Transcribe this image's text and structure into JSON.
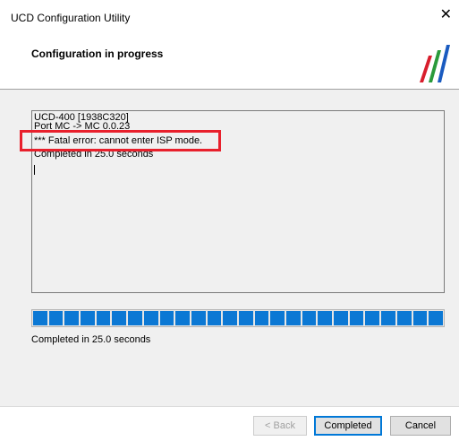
{
  "window": {
    "title": "UCD Configuration Utility",
    "close_glyph": "✕"
  },
  "header": {
    "title": "Configuration in progress",
    "logo_icon": "tricolor-slash-logo"
  },
  "log": {
    "lines": [
      "UCD-400 [1938C320]",
      "Port MC -> MC 0.0.23",
      "*** Fatal error: cannot enter ISP mode.",
      "Completed in 25.0 seconds"
    ]
  },
  "progress": {
    "fraction": 1.0,
    "segments": 26
  },
  "status_text": "Completed in 25.0 seconds",
  "buttons": {
    "back": "< Back",
    "completed": "Completed",
    "cancel": "Cancel"
  },
  "colors": {
    "highlight": "#e8202c",
    "progress": "#0b78d4"
  }
}
